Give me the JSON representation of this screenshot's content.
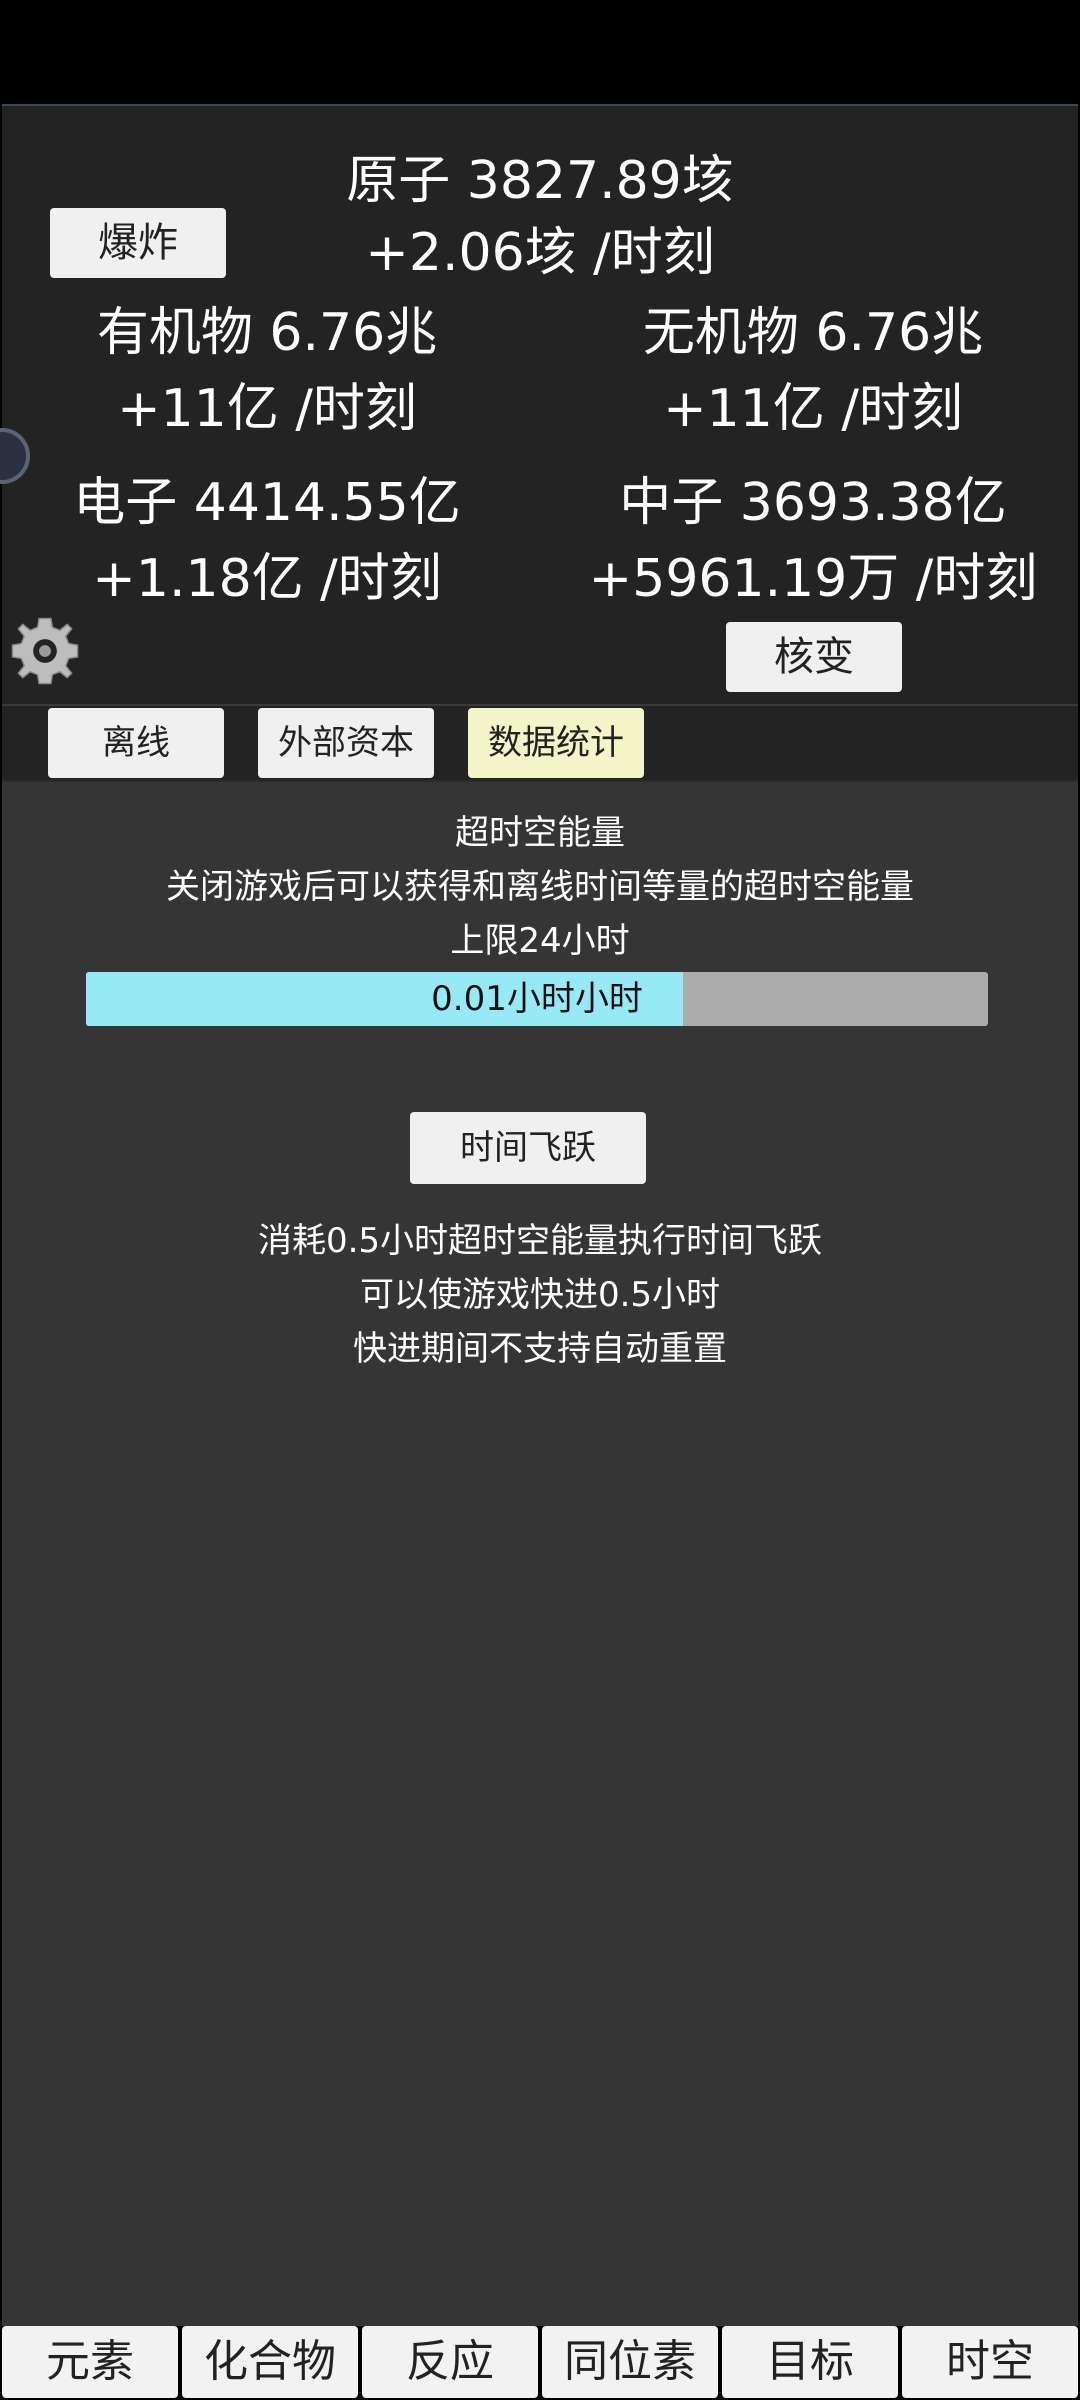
{
  "top": {
    "atom": "原子 3827.89垓",
    "atom_rate": "+2.06垓 /时刻",
    "explode_label": "爆炸",
    "organic": "有机物 6.76兆",
    "organic_rate": "+11亿 /时刻",
    "inorganic": "无机物 6.76兆",
    "inorganic_rate": "+11亿 /时刻",
    "electron": "电子 4414.55亿",
    "electron_rate": "+1.18亿 /时刻",
    "neutron": "中子 3693.38亿",
    "neutron_rate": "+5961.19万 /时刻",
    "fission_label": "核变"
  },
  "tabs": [
    {
      "label": "离线"
    },
    {
      "label": "外部资本"
    },
    {
      "label": "数据统计"
    }
  ],
  "offline": {
    "title": "超时空能量",
    "desc": "关闭游戏后可以获得和离线时间等量的超时空能量",
    "limit": "上限24小时",
    "progress_label": "0.01小时小时",
    "progress_fraction": 0.662,
    "time_jump_label": "时间飞跃",
    "jump_desc_1": "消耗0.5小时超时空能量执行时间飞跃",
    "jump_desc_2": "可以使游戏快进0.5小时",
    "jump_desc_3": "快进期间不支持自动重置"
  },
  "bottom_nav": [
    {
      "label": "元素"
    },
    {
      "label": "化合物"
    },
    {
      "label": "反应"
    },
    {
      "label": "同位素"
    },
    {
      "label": "目标"
    },
    {
      "label": "时空"
    }
  ],
  "colors": {
    "progress_fill": "#97e9f6",
    "active_tab": "#f3f4c7"
  }
}
